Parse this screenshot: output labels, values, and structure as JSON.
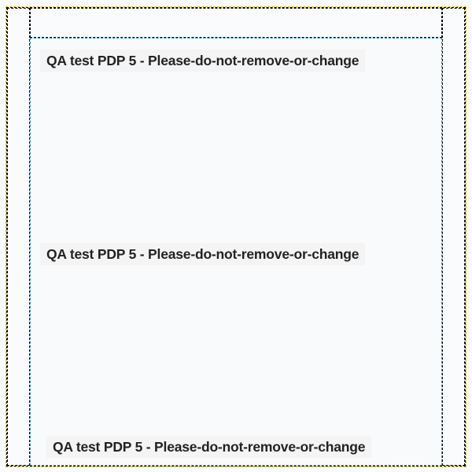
{
  "labels": {
    "item1": "QA test PDP 5 - Please-do-not-remove-or-change",
    "item2": "QA test PDP 5 - Please-do-not-remove-or-change",
    "item3": "QA test PDP 5 - Please-do-not-remove-or-change"
  }
}
